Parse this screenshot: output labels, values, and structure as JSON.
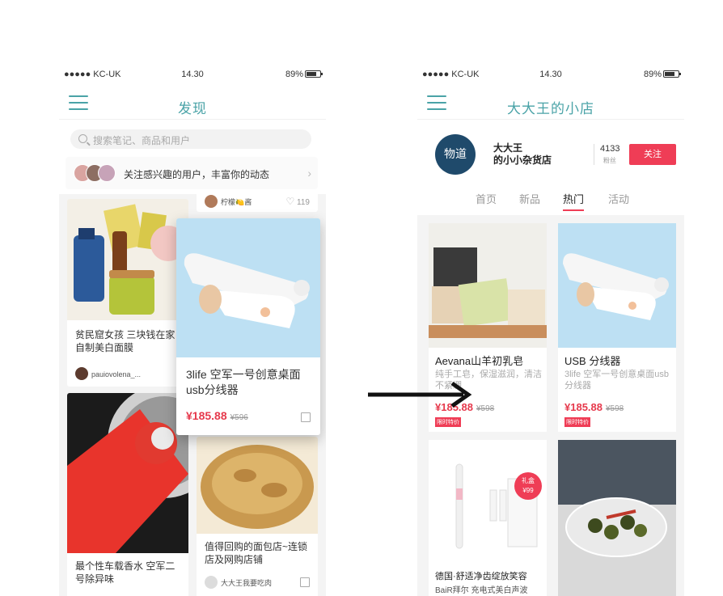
{
  "left_screen": {
    "status": {
      "carrier": "●●●●● KC-UK",
      "time": "14.30",
      "battery": "89%"
    },
    "nav_title": "发现",
    "search_placeholder": "搜索笔记、商品和用户",
    "follow_banner": "关注感兴趣的用户，丰富你的动态",
    "top_strip": {
      "author": "柠檬🍋酱",
      "likes": "119"
    },
    "cards": [
      {
        "title": "贫民窟女孩 三块钱在家自制美白面膜",
        "author": "pauiovolena_..."
      },
      {
        "title": "最个性车载香水 空军二号除异味"
      },
      {
        "title": "值得回购的面包店~连锁店及网购店铺",
        "author": "大大王我要吃肉"
      }
    ],
    "featured_card": {
      "title": "3life 空军一号创意桌面usb分线器",
      "price": "¥185.88",
      "old_price": "¥596"
    }
  },
  "right_screen": {
    "status": {
      "carrier": "●●●●● KC-UK",
      "time": "14.30",
      "battery": "89%"
    },
    "nav_title": "大大王的小店",
    "store": {
      "logo_text": "物道",
      "name_line1": "大大王",
      "name_line2": "的小小杂货店",
      "fans_count": "4133",
      "fans_label": "粉丝",
      "follow_label": "关注"
    },
    "tabs": [
      "首页",
      "新品",
      "热门",
      "活动"
    ],
    "active_tab": "热门",
    "products": [
      {
        "title": "Aevana山羊初乳皂",
        "desc": "纯手工皂，保湿滋润，清洁不紧绷",
        "price": "¥185.88",
        "old_price": "¥598",
        "tag": "限时特价"
      },
      {
        "title": "USB 分线器",
        "desc": "3life 空军一号创意桌面usb分线器",
        "price": "¥185.88",
        "old_price": "¥598",
        "tag": "限时特价"
      },
      {
        "title": "德国·舒适净齿绽放笑容",
        "desc": "BaiR拜尔 充电式美白声波",
        "badge_line1": "礼盒",
        "badge_line2": "¥99"
      },
      {
        "title": ""
      }
    ]
  },
  "colors": {
    "accent": "#4aa3a7",
    "price_red": "#e6394c",
    "follow_red": "#ef3d56",
    "logo_navy": "#1f4a6b"
  }
}
